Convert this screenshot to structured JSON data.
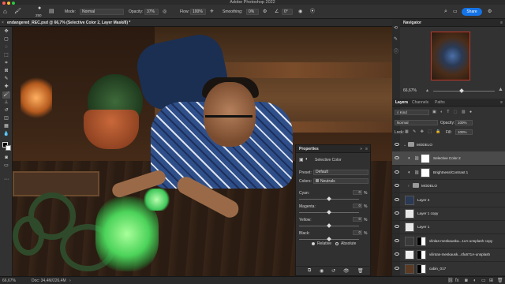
{
  "app": {
    "title": "Adobe Photoshop 2022"
  },
  "options": {
    "brush_size": "250",
    "mode_label": "Mode:",
    "mode_value": "Normal",
    "opacity_label": "Opacity:",
    "opacity_value": "37%",
    "flow_label": "Flow:",
    "flow_value": "100%",
    "smoothing_label": "Smoothing:",
    "smoothing_value": "0%",
    "angle_value": "0°",
    "share_label": "Share"
  },
  "document": {
    "tab_title": "endangered_REC.psd @ 66,7% (Selective Color 2, Layer Mask/8) *",
    "zoom": "66,67%",
    "doc_info": "Doc: 34,4M/226,4M"
  },
  "properties": {
    "title": "Properties",
    "adjustment": "Selective Color",
    "preset_label": "Preset:",
    "preset_value": "Default",
    "colors_label": "Colors:",
    "colors_value": "Neutrals",
    "sliders": [
      {
        "label": "Cyan:",
        "value": "0",
        "unit": "%",
        "level": 0.5
      },
      {
        "label": "Magenta:",
        "value": "0",
        "unit": "%",
        "level": 0.5
      },
      {
        "label": "Yellow:",
        "value": "0",
        "unit": "%",
        "level": 0.5
      },
      {
        "label": "Black:",
        "value": "0",
        "unit": "%",
        "level": 0.5
      }
    ],
    "relative_label": "Relative",
    "absolute_label": "Absolute",
    "method_selected": "Relative"
  },
  "navigator": {
    "title": "Navigator",
    "zoom": "66,67%"
  },
  "layers_panel": {
    "tabs": [
      "Layers",
      "Channels",
      "Paths"
    ],
    "active_tab": "Layers",
    "filter": "Kind",
    "blend_mode": "Normal",
    "opacity_label": "Opacity:",
    "opacity_value": "100%",
    "lock_label": "Lock:",
    "fill_label": "Fill:",
    "fill_value": "100%",
    "layers": [
      {
        "name": "MODELO",
        "type": "group",
        "expanded": true,
        "indent": 0,
        "selected": false
      },
      {
        "name": "Selective Color 2",
        "type": "adjustment",
        "indent": 1,
        "selected": true
      },
      {
        "name": "Brightness/Contrast 1",
        "type": "adjustment",
        "indent": 1,
        "selected": false
      },
      {
        "name": "MODELO",
        "type": "group",
        "expanded": false,
        "indent": 1,
        "selected": false
      },
      {
        "name": "Layer 4",
        "type": "pixel",
        "indent": 0,
        "selected": false
      },
      {
        "name": "Layer 1 copy",
        "type": "pixel",
        "indent": 0,
        "selected": false
      },
      {
        "name": "Layer 1",
        "type": "pixel",
        "indent": 0,
        "selected": false
      },
      {
        "name": "vlinlas-meskauska...1vA-unsplash copy",
        "type": "pixel",
        "indent": 0,
        "selected": false
      },
      {
        "name": "vilintas-meskausk...4fu671A-unsplash",
        "type": "pixel",
        "indent": 0,
        "selected": false
      },
      {
        "name": "cabin_017",
        "type": "pixel",
        "indent": 0,
        "selected": false
      }
    ]
  },
  "colors": {
    "accent": "#1473e6",
    "selected_row": "#4a4a4a"
  }
}
